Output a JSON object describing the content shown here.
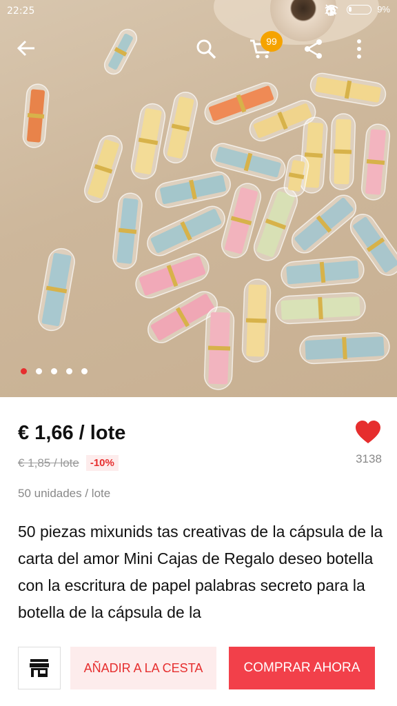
{
  "status_bar": {
    "time": "22:25",
    "battery_pct": "9%"
  },
  "toolbar": {
    "cart_badge": "99"
  },
  "gallery": {
    "dot_count": 5,
    "active_index": 0
  },
  "product": {
    "price": "€ 1,66 / lote",
    "old_price": "€ 1,85 / lote",
    "discount": "-10%",
    "units": "50 unidades / lote",
    "likes": "3138",
    "title": "50 piezas mixunids tas creativas de la cápsula de la carta del amor Mini Cajas de Regalo deseo botella con la escritura de papel palabras secreto para la botella de la cápsula de la"
  },
  "actions": {
    "add_to_cart": "AÑADIR A LA CESTA",
    "buy_now": "COMPRAR AHORA"
  },
  "colors": {
    "accent": "#e62e2e",
    "buy": "#f2404a",
    "badge": "#f5a300"
  }
}
